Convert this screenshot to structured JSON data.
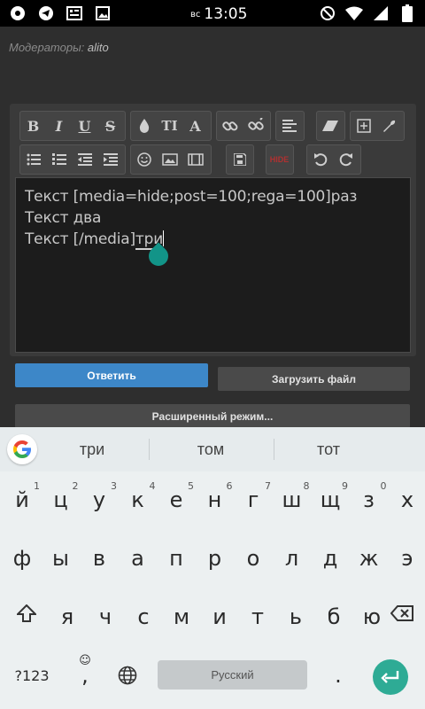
{
  "status_bar": {
    "day": "вс",
    "time": "13:05",
    "left_icons": [
      "photos-icon",
      "telegram-icon",
      "screenshot-icon",
      "gallery-icon"
    ],
    "right_icons": [
      "do-not-disturb-icon",
      "wifi-icon",
      "signal-icon",
      "battery-icon"
    ]
  },
  "forum": {
    "moderators_label": "Модераторы:",
    "moderator_name": "alito"
  },
  "editor": {
    "toolbar_row1": {
      "bold": "B",
      "italic": "I",
      "underline": "U",
      "strike": "S",
      "font_size": "TI",
      "font_family": "A"
    },
    "hide_label": "HIDE",
    "lines": [
      "Текст [media=hide;post=100;rega=100]раз",
      "Текст два",
      "Текст [/media]"
    ],
    "composing_word": "три"
  },
  "buttons": {
    "reply": "Ответить",
    "upload": "Загрузить файл",
    "advanced": "Расширенный режим..."
  },
  "keyboard": {
    "suggestions": [
      "три",
      "том",
      "тот"
    ],
    "row1": [
      {
        "key": "й",
        "hint": "1"
      },
      {
        "key": "ц",
        "hint": "2"
      },
      {
        "key": "у",
        "hint": "3"
      },
      {
        "key": "к",
        "hint": "4"
      },
      {
        "key": "е",
        "hint": "5"
      },
      {
        "key": "н",
        "hint": "6"
      },
      {
        "key": "г",
        "hint": "7"
      },
      {
        "key": "ш",
        "hint": "8"
      },
      {
        "key": "щ",
        "hint": "9"
      },
      {
        "key": "з",
        "hint": "0"
      },
      {
        "key": "х",
        "hint": ""
      }
    ],
    "row2": [
      "ф",
      "ы",
      "в",
      "а",
      "п",
      "р",
      "о",
      "л",
      "д",
      "ж",
      "э"
    ],
    "row3": [
      "я",
      "ч",
      "с",
      "м",
      "и",
      "т",
      "ь",
      "б",
      "ю"
    ],
    "symbols_key": "?123",
    "comma": ",",
    "space_label": "Русский",
    "period": ".",
    "accent_color": "#2eab95"
  }
}
